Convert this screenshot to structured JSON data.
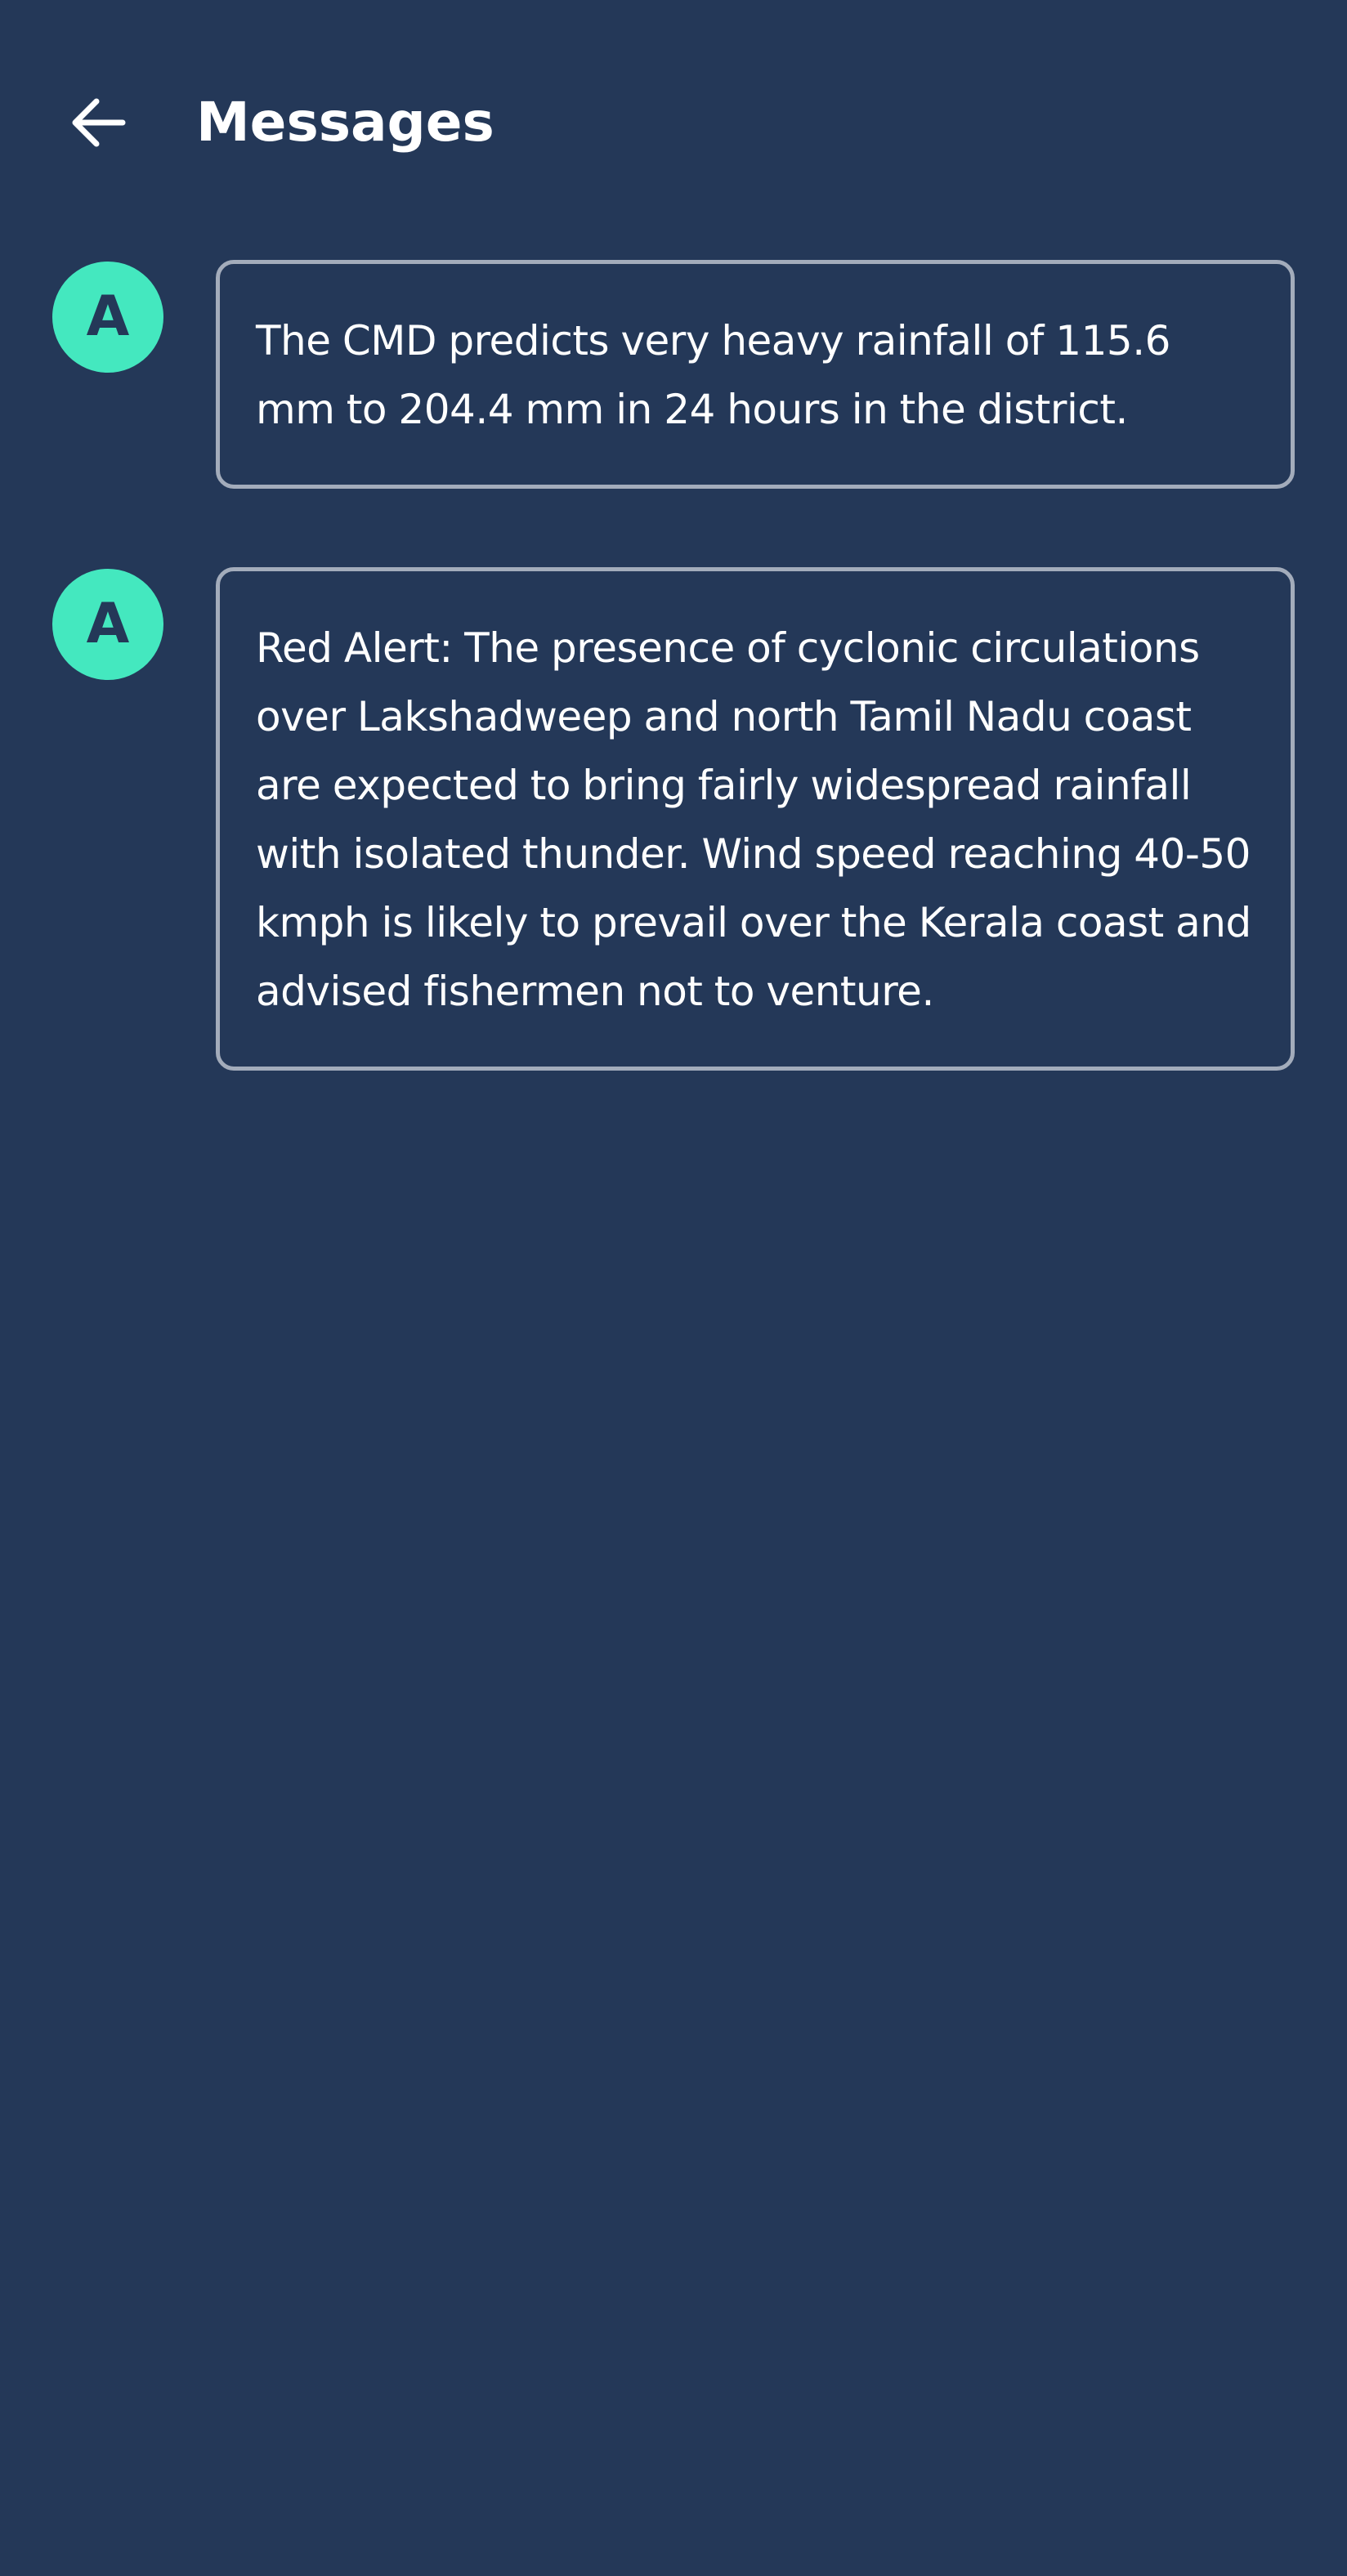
{
  "header": {
    "back_icon": "arrow-left-icon",
    "title": "Messages"
  },
  "messages": [
    {
      "avatar_letter": "A",
      "avatar_color": "#44e8bf",
      "text": "The CMD predicts very heavy rainfall of 115.6 mm to 204.4 mm in 24 hours in the district."
    },
    {
      "avatar_letter": "A",
      "avatar_color": "#44e8bf",
      "text": "Red Alert: The presence of cyclonic circulations over Lakshadweep and north Tamil Nadu coast are expected to bring fairly widespread rainfall with isolated thunder. Wind speed reaching 40-50 kmph is likely to prevail over the Kerala coast and advised fishermen not to venture."
    }
  ],
  "colors": {
    "background": "#243858",
    "bubble_border": "#a3acbb",
    "accent": "#44e8bf",
    "text": "#ffffff"
  }
}
